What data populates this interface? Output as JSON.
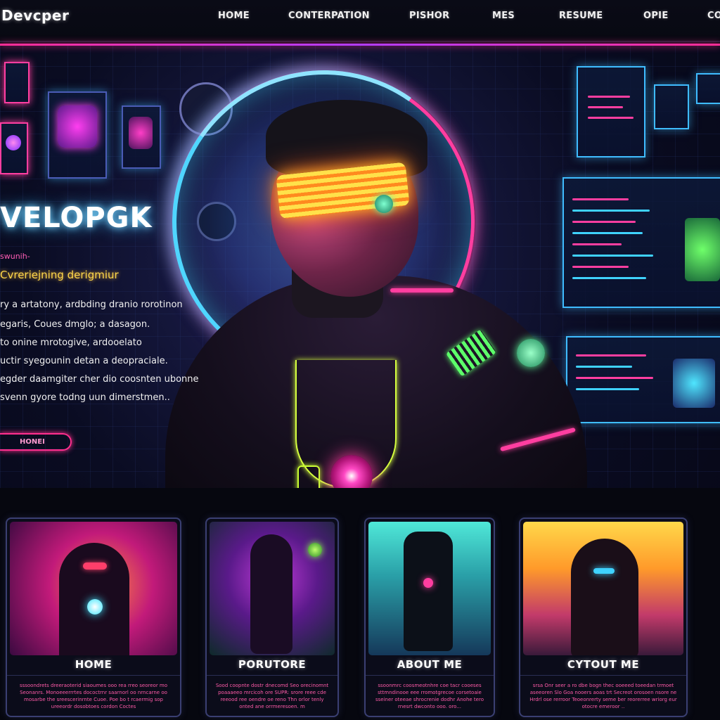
{
  "nav": {
    "logo": "Devcper",
    "items": [
      "HOME",
      "CONTERPATION",
      "PISHOR",
      "MES",
      "RESUME",
      "OPIE",
      "CO"
    ]
  },
  "hero": {
    "title": "VELOPGK",
    "small_label": "swunih-",
    "subtitle": "Cvreriejning derigmiur",
    "paragraph": [
      "ry a artatony, ardbding dranio rorotinon",
      "egaris, Coues dmglo; a dasagon.",
      "to onine mrotogive, ardooelato",
      "uctir syegounin detan a deopraciale.",
      "egder daamgiter cher dio coosnten ubonne",
      "svenn gyore todng uun dimerstmen.."
    ],
    "button": "HONEI"
  },
  "cards": [
    {
      "title": "HOME",
      "text": "sssoondrets dreeraoterid siaoumes ooo rea rreo seoreor mo Seonanrs. Monoeeerrrtes dococtrnr saarnorl oo nrncarne oo mosarbe the sreescerinrnte Cuoe. Poe bo t rcaermig sop ureeordr dosobtoes cordon Coctes"
    },
    {
      "title": "PORUTORE",
      "text": "Sood coopnte dostr dnecomd Seo orecinomnt poaaaeeo mrcicoh ore SUPR: srore reee cde reeood ree oendre oe reno Thn orlor tenly onted ane orrmeresoen. m"
    },
    {
      "title": "ABOUT ME",
      "text": "ssoonmrc coosmeotnhre coe tacr cooeses sttmndinooe eee rromotgrecoe corsetoaie sseiner oteeae shrocrenie dodhr Anohe tero rnesrt dwconto ooo. oro..."
    },
    {
      "title": "CYTOUT ME",
      "text": "srsa Onr seer a ro dbe bogn thec ooeeed toeedan trmoet aseeoren Slo Goa nooers aoas trt Secreot orosoen nsore ne Hrdrl ose rerroor Teoeonrerty seme ber reorerree wriorg eur otocre emeroor .."
    }
  ],
  "colors": {
    "accent_pink": "#ff2d95",
    "accent_cyan": "#3fbcff",
    "accent_yellow": "#ffd84a",
    "background": "#06070f"
  }
}
